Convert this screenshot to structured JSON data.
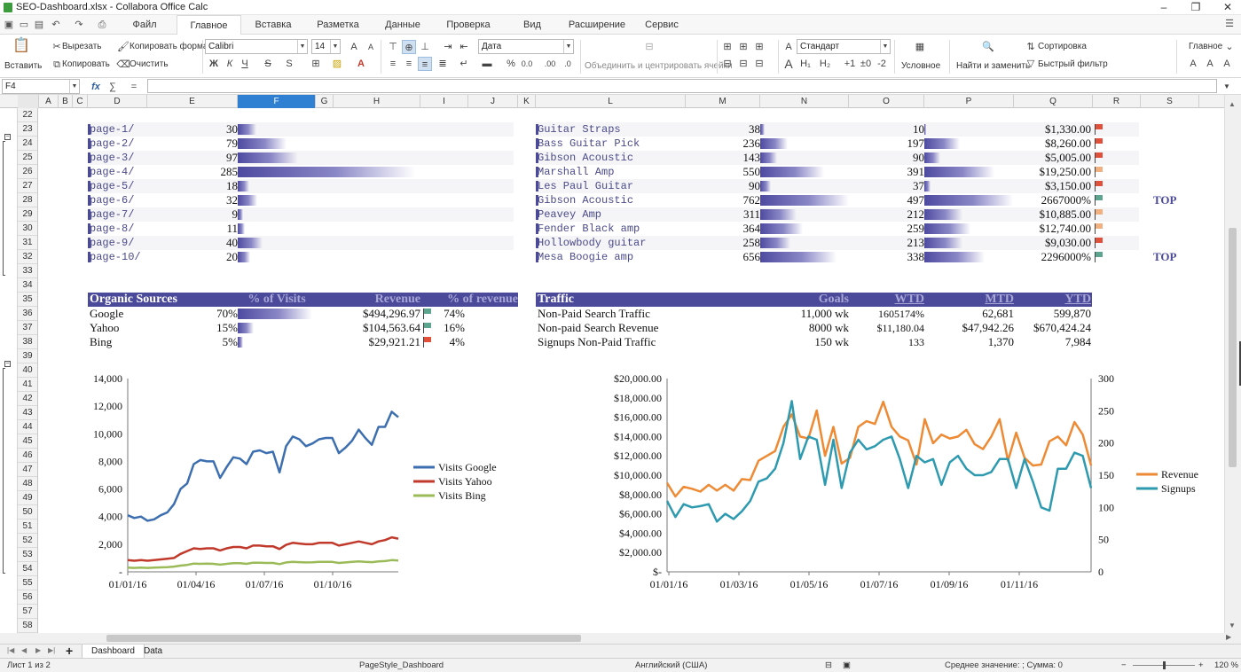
{
  "window": {
    "title": "SEO-Dashboard.xlsx - Collabora Office Calc"
  },
  "menu": {
    "tabs": [
      "Файл",
      "Главное",
      "Вставка",
      "Разметка",
      "Данные",
      "Проверка",
      "Вид",
      "Расширение",
      "Сервис"
    ],
    "active": "Главное"
  },
  "ribbon": {
    "paste": "Вставить",
    "cut": "Вырезать",
    "copy": "Копировать",
    "clone": "Копировать формат",
    "clear": "Очистить",
    "font_name": "Calibri",
    "font_size": "14",
    "bold": "Ж",
    "italic": "К",
    "underline": "Ч",
    "strike": "S",
    "number_format": "Дата",
    "merge": "Объединить и центрировать ячейки",
    "style_name": "Стандарт",
    "conditional": "Условное",
    "find_replace": "Найти и заменить",
    "sort": "Сортировка",
    "autofilter": "Быстрый фильтр",
    "home_style": "Главное"
  },
  "formula": {
    "name_box": "F4",
    "fx": "fx",
    "sum": "∑",
    "eq": "="
  },
  "columns": [
    "A",
    "B",
    "C",
    "D",
    "E",
    "F",
    "G",
    "H",
    "I",
    "J",
    "K",
    "L",
    "M",
    "N",
    "O",
    "P",
    "Q",
    "R",
    "S"
  ],
  "current_column": "F",
  "rows": [
    "22",
    "23",
    "24",
    "25",
    "26",
    "27",
    "28",
    "29",
    "30",
    "31",
    "32",
    "33",
    "34",
    "35",
    "36",
    "37",
    "38",
    "39",
    "40",
    "41",
    "42",
    "43",
    "44",
    "45",
    "46",
    "47",
    "48",
    "49",
    "50",
    "51",
    "52",
    "53",
    "54",
    "55",
    "56",
    "57",
    "58"
  ],
  "pages": [
    {
      "page": "page-1/",
      "visits": "30",
      "bar": 0.105
    },
    {
      "page": "page-2/",
      "visits": "79",
      "bar": 0.277
    },
    {
      "page": "page-3/",
      "visits": "97",
      "bar": 0.34
    },
    {
      "page": "page-4/",
      "visits": "285",
      "bar": 1.0
    },
    {
      "page": "page-5/",
      "visits": "18",
      "bar": 0.063
    },
    {
      "page": "page-6/",
      "visits": "32",
      "bar": 0.112
    },
    {
      "page": "page-7/",
      "visits": "9",
      "bar": 0.032
    },
    {
      "page": "page-8/",
      "visits": "11",
      "bar": 0.039
    },
    {
      "page": "page-9/",
      "visits": "40",
      "bar": 0.14
    },
    {
      "page": "page-10/",
      "visits": "20",
      "bar": 0.07
    }
  ],
  "products": [
    {
      "name": "Guitar Straps",
      "visits": "38",
      "vbar": 0.05,
      "goal": "10",
      "gbar": 0.02,
      "revenue": "$1,330.00",
      "flag": "#e0503a",
      "top": ""
    },
    {
      "name": "Bass Guitar Pick",
      "visits": "236",
      "vbar": 0.31,
      "goal": "197",
      "gbar": 0.4,
      "revenue": "$8,260.00",
      "flag": "#e0503a",
      "top": ""
    },
    {
      "name": "Gibson Acoustic",
      "visits": "143",
      "vbar": 0.19,
      "goal": "90",
      "gbar": 0.18,
      "revenue": "$5,005.00",
      "flag": "#e0503a",
      "top": ""
    },
    {
      "name": "Marshall Amp",
      "visits": "550",
      "vbar": 0.72,
      "goal": "391",
      "gbar": 0.79,
      "revenue": "$19,250.00",
      "flag": "#f0b080",
      "top": ""
    },
    {
      "name": "Les Paul Guitar",
      "visits": "90",
      "vbar": 0.12,
      "goal": "37",
      "gbar": 0.07,
      "revenue": "$3,150.00",
      "flag": "#e0503a",
      "top": ""
    },
    {
      "name": "Gibson Acoustic",
      "visits": "762",
      "vbar": 1.0,
      "goal": "497",
      "gbar": 1.0,
      "revenue": "2667000%",
      "flag": "#5ea58f",
      "top": "TOP"
    },
    {
      "name": "Peavey Amp",
      "visits": "311",
      "vbar": 0.41,
      "goal": "212",
      "gbar": 0.43,
      "revenue": "$10,885.00",
      "flag": "#f0b080",
      "top": ""
    },
    {
      "name": "Fender Black amp",
      "visits": "364",
      "vbar": 0.48,
      "goal": "259",
      "gbar": 0.52,
      "revenue": "$12,740.00",
      "flag": "#f0b080",
      "top": ""
    },
    {
      "name": "Hollowbody guitar",
      "visits": "258",
      "vbar": 0.34,
      "goal": "213",
      "gbar": 0.43,
      "revenue": "$9,030.00",
      "flag": "#e0503a",
      "top": ""
    },
    {
      "name": "Mesa Boogie amp",
      "visits": "656",
      "vbar": 0.86,
      "goal": "338",
      "gbar": 0.68,
      "revenue": "2296000%",
      "flag": "#5ea58f",
      "top": "TOP"
    }
  ],
  "organic": {
    "headers": [
      "Organic Sources",
      "% of Visits",
      "Revenue",
      "% of revenue"
    ],
    "rows": [
      {
        "source": "Google",
        "pct": "70%",
        "bar": 0.7,
        "revenue": "$494,296.97",
        "flag": "#5ea58f",
        "rpct": "74%"
      },
      {
        "source": "Yahoo",
        "pct": "15%",
        "bar": 0.15,
        "revenue": "$104,563.64",
        "flag": "#5ea58f",
        "rpct": "16%"
      },
      {
        "source": "Bing",
        "pct": "5%",
        "bar": 0.05,
        "revenue": "$29,921.21",
        "flag": "#e0503a",
        "rpct": "4%"
      }
    ]
  },
  "traffic": {
    "headers": [
      "Traffic",
      "Goals",
      "WTD",
      "MTD",
      "YTD"
    ],
    "rows": [
      {
        "name": "Non-Paid Search Traffic",
        "goals": "11,000 wk",
        "wtd": "1605174%",
        "mtd": "62,681",
        "ytd": "599,870"
      },
      {
        "name": "Non-paid Search Revenue",
        "goals": "8000 wk",
        "wtd": "$11,180.04",
        "mtd": "$47,942.26",
        "ytd": "$670,424.24"
      },
      {
        "name": "Signups Non-Paid Traffic",
        "goals": "150 wk",
        "wtd": "133",
        "mtd": "1,370",
        "ytd": "7,984"
      }
    ]
  },
  "chart_data": [
    {
      "type": "line",
      "ylim": [
        0,
        14000
      ],
      "yticks": [
        "14,000",
        "12,000",
        "10,000",
        "8,000",
        "6,000",
        "4,000",
        "2,000",
        "-"
      ],
      "xticks": [
        "01/01/16",
        "01/04/16",
        "01/07/16",
        "01/10/16"
      ],
      "series": [
        {
          "name": "Visits Google",
          "color": "#3d6fb0",
          "values": [
            4100,
            3900,
            4000,
            3700,
            3800,
            4100,
            4300,
            4900,
            6000,
            6400,
            7800,
            8100,
            8000,
            8000,
            6800,
            7600,
            8300,
            8200,
            7800,
            8700,
            8800,
            8600,
            8700,
            7200,
            9100,
            9800,
            9600,
            9100,
            9300,
            9600,
            9700,
            9700,
            8600,
            9000,
            9500,
            10300,
            9700,
            9200,
            10500,
            10500,
            11600,
            11200
          ]
        },
        {
          "name": "Visits Yahoo",
          "color": "#c0392b",
          "values": [
            850,
            800,
            850,
            800,
            850,
            900,
            950,
            1000,
            1300,
            1500,
            1700,
            1650,
            1700,
            1700,
            1550,
            1700,
            1800,
            1800,
            1700,
            1900,
            1900,
            1850,
            1850,
            1650,
            1950,
            2100,
            2050,
            2000,
            2000,
            2100,
            2100,
            2100,
            1900,
            2000,
            2100,
            2200,
            2100,
            2000,
            2200,
            2300,
            2500,
            2400
          ]
        },
        {
          "name": "Visits Bing",
          "color": "#9bbb59",
          "values": [
            300,
            280,
            300,
            280,
            300,
            320,
            340,
            380,
            450,
            500,
            600,
            580,
            590,
            580,
            520,
            580,
            620,
            620,
            580,
            660,
            660,
            640,
            640,
            560,
            680,
            720,
            700,
            680,
            690,
            720,
            720,
            720,
            640,
            680,
            720,
            760,
            720,
            700,
            750,
            780,
            850,
            820
          ]
        }
      ]
    },
    {
      "type": "line",
      "ylim": [
        0,
        20000
      ],
      "y2lim": [
        0,
        300
      ],
      "yticks": [
        "$20,000.00",
        "$18,000.00",
        "$16,000.00",
        "$14,000.00",
        "$12,000.00",
        "$10,000.00",
        "$8,000.00",
        "$6,000.00",
        "$4,000.00",
        "$2,000.00",
        "$-"
      ],
      "y2ticks": [
        "300",
        "250",
        "200",
        "150",
        "100",
        "50",
        "0"
      ],
      "xticks": [
        "01/01/16",
        "01/03/16",
        "01/05/16",
        "01/07/16",
        "01/09/16",
        "01/11/16"
      ],
      "series": [
        {
          "name": "Revenue",
          "color": "#ee8a34",
          "axis": "left",
          "values": [
            9200,
            7800,
            8800,
            8600,
            8300,
            9000,
            8400,
            9000,
            8400,
            9600,
            9500,
            11500,
            12000,
            12500,
            15000,
            16300,
            14000,
            13800,
            16700,
            12000,
            15000,
            11200,
            11800,
            15000,
            15600,
            15300,
            17600,
            15000,
            14000,
            13600,
            11100,
            15800,
            13300,
            14200,
            13800,
            14000,
            14700,
            13200,
            12700,
            14000,
            15800,
            11500,
            14400,
            11800,
            11000,
            11100,
            13500,
            14000,
            13100,
            15500,
            14200,
            11000
          ]
        },
        {
          "name": "Signups",
          "color": "#2e9ab0",
          "axis": "right",
          "values": [
            110,
            85,
            105,
            100,
            102,
            105,
            78,
            90,
            82,
            94,
            110,
            140,
            145,
            160,
            200,
            265,
            175,
            210,
            205,
            135,
            205,
            130,
            185,
            205,
            190,
            195,
            205,
            210,
            175,
            130,
            180,
            170,
            175,
            135,
            170,
            180,
            160,
            150,
            150,
            155,
            175,
            175,
            130,
            175,
            140,
            100,
            95,
            160,
            160,
            185,
            180,
            130
          ]
        }
      ]
    }
  ],
  "sheets": [
    "Dashboard",
    "Data"
  ],
  "active_sheet": "Dashboard",
  "status": {
    "sheet": "Лист 1 из 2",
    "page_style": "PageStyle_Dashboard",
    "language": "Английский (США)",
    "stats": "Среднее значение: ; Сумма: 0",
    "zoom": "120 %"
  }
}
